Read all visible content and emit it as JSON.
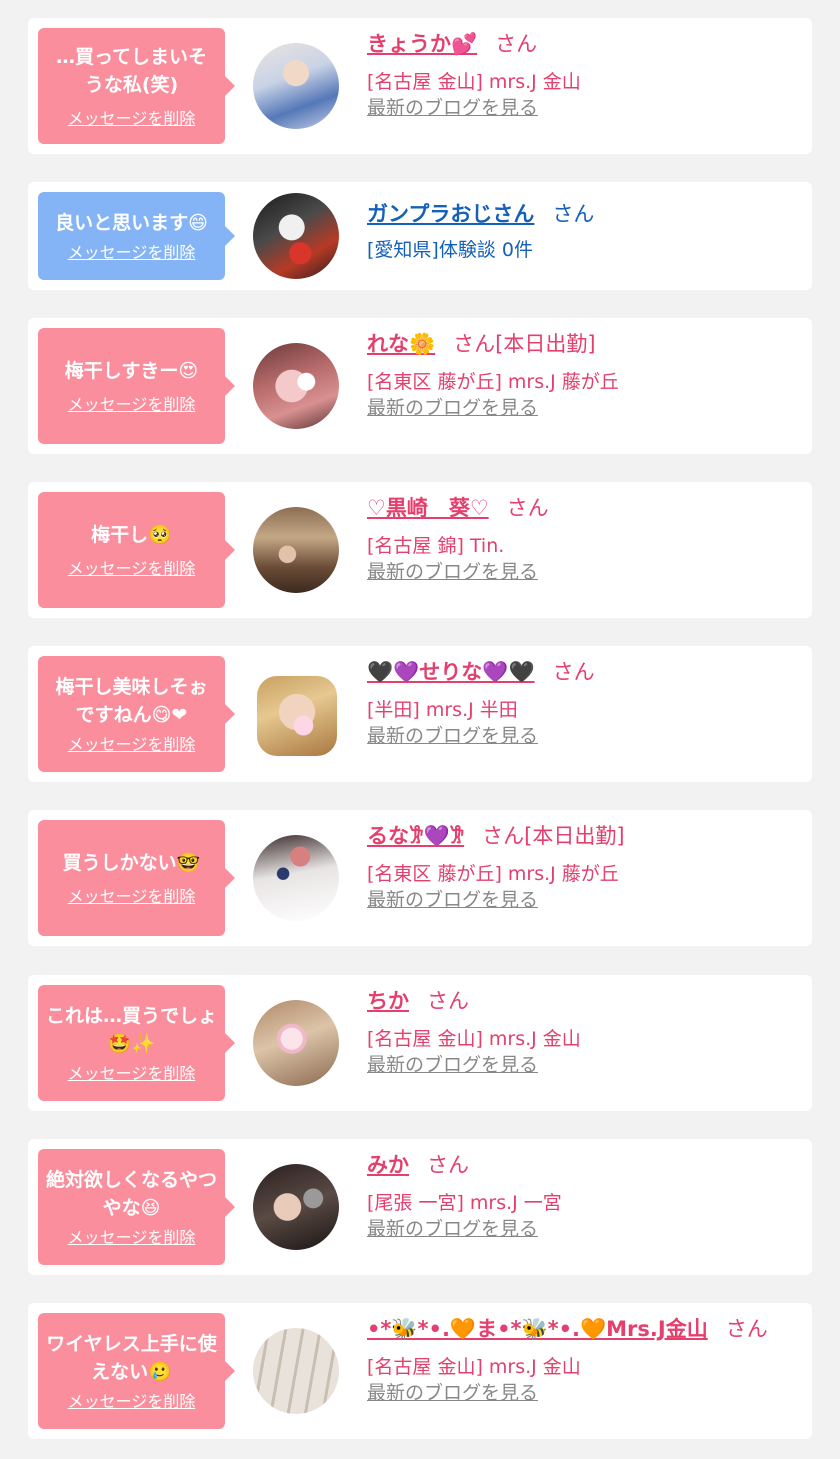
{
  "colors": {
    "bubble_pink": "#fb8e9d",
    "bubble_blue": "#84b4f5",
    "text_pink": "#e4406e",
    "text_blue": "#1560b8",
    "link_gray": "#888888"
  },
  "delete_label": "メッセージを削除",
  "blog_label": "最新のブログを見る",
  "san_label": "さん",
  "items": [
    {
      "message": "…買ってしまいそうな私(笑)",
      "name": "きょうか💕",
      "status": "",
      "shop": "[名古屋 金山] mrs.J 金山",
      "has_blog": true,
      "theme": "pink"
    },
    {
      "message": "良いと思います😄",
      "name": "ガンプラおじさん",
      "status": "",
      "shop": "[愛知県]体験談 0件",
      "has_blog": false,
      "theme": "blue"
    },
    {
      "message": "梅干しすきー😍",
      "name": "れな🌼",
      "status": "[本日出勤]",
      "shop": "[名東区 藤が丘] mrs.J 藤が丘",
      "has_blog": true,
      "theme": "pink"
    },
    {
      "message": "梅干し🥺",
      "name": "♡黒崎　葵♡",
      "status": "",
      "shop": "[名古屋 錦] Tin.",
      "has_blog": true,
      "theme": "pink"
    },
    {
      "message": "梅干し美味しそぉですねん😋❤",
      "name": "🖤💜せりな💜🖤",
      "status": "",
      "shop": "[半田] mrs.J 半田",
      "has_blog": true,
      "theme": "pink"
    },
    {
      "message": "買うしかない🤓",
      "name": "るな𐦂💜𐦂",
      "status": "[本日出勤]",
      "shop": "[名東区 藤が丘] mrs.J 藤が丘",
      "has_blog": true,
      "theme": "pink"
    },
    {
      "message": "これは…買うでしょ🤩✨",
      "name": "ちか",
      "status": "",
      "shop": "[名古屋 金山] mrs.J 金山",
      "has_blog": true,
      "theme": "pink"
    },
    {
      "message": "絶対欲しくなるやつやな😆",
      "name": "みか",
      "status": "",
      "shop": "[尾張 一宮] mrs.J 一宮",
      "has_blog": true,
      "theme": "pink"
    },
    {
      "message": "ワイヤレス上手に使えない🥲",
      "name": "•*🐝*•.🧡ま•*🐝*•.🧡Mrs.J金山",
      "status": "",
      "shop": "[名古屋 金山] mrs.J 金山",
      "has_blog": true,
      "theme": "pink"
    }
  ]
}
